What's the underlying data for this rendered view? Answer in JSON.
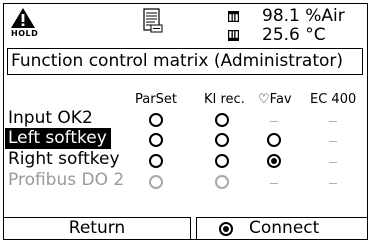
{
  "status": {
    "hold_label": "HOLD",
    "measurements": [
      {
        "icon": "sensor-square-icon",
        "value": "98.1 %Air"
      },
      {
        "icon": "sensor-square-icon",
        "value": "25.6 °C"
      }
    ],
    "doc_icon": "logbook-document-icon"
  },
  "title": "Function control matrix (Administrator)",
  "columns": [
    "ParSet",
    "KI rec.",
    "♡Fav",
    "EC 400"
  ],
  "rows": [
    {
      "label": "Input OK2",
      "state": "normal",
      "cells": [
        "off",
        "off",
        "dash",
        "dash"
      ]
    },
    {
      "label": "Left softkey",
      "state": "selected",
      "cells": [
        "off",
        "off",
        "off",
        "dash"
      ]
    },
    {
      "label": "Right softkey",
      "state": "normal",
      "cells": [
        "off",
        "off",
        "on",
        "dash"
      ]
    },
    {
      "label": "Profibus DO 2",
      "state": "disabled",
      "cells": [
        "off",
        "off",
        "dash",
        "dash"
      ]
    }
  ],
  "softkeys": {
    "left": "Return",
    "right": "Connect"
  },
  "colors": {
    "foreground": "#000000",
    "background": "#ffffff",
    "disabled": "#9a9a9a"
  }
}
